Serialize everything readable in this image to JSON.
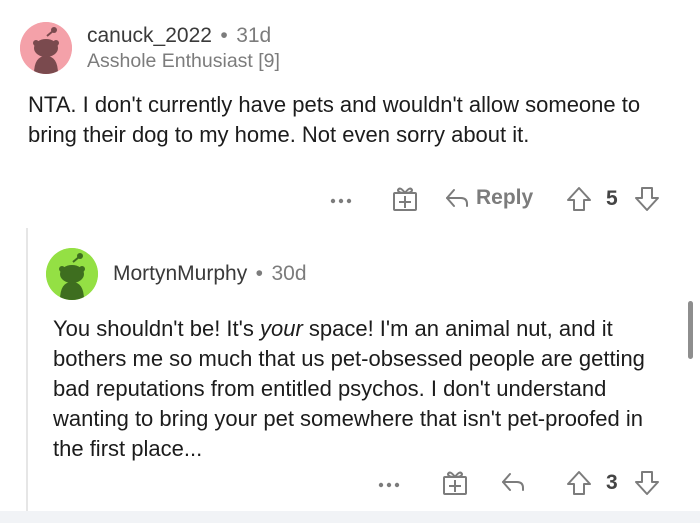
{
  "comment": {
    "username": "canuck_2022",
    "separator": "•",
    "age": "31d",
    "flair": "Asshole Enthusiast [9]",
    "text": "NTA. I don't currently have pets and wouldn't allow someone to bring their dog to my home. Not even sorry about it.",
    "more_icon": "more-dots-icon",
    "award_icon": "gift-award-icon",
    "reply_label": "Reply",
    "score": "5",
    "avatar_bg": "#f4a1a9"
  },
  "reply": {
    "username": "MortynMurphy",
    "separator": "•",
    "age": "30d",
    "text_before": "You shouldn't be! It's ",
    "text_italic": "your",
    "text_after": " space! I'm an animal nut, and it bothers me so much that us pet-obsessed people are getting bad reputations from entitled psychos. I don't understand wanting to bring your pet somewhere that isn't pet-proofed in the first place...",
    "more_icon": "more-dots-icon",
    "award_icon": "gift-award-icon",
    "score": "3",
    "avatar_bg": "#94e044"
  },
  "colors": {
    "meta_gray": "#7c7c7c",
    "text": "#1c1c1c",
    "thread_line": "#e6e6e6"
  }
}
